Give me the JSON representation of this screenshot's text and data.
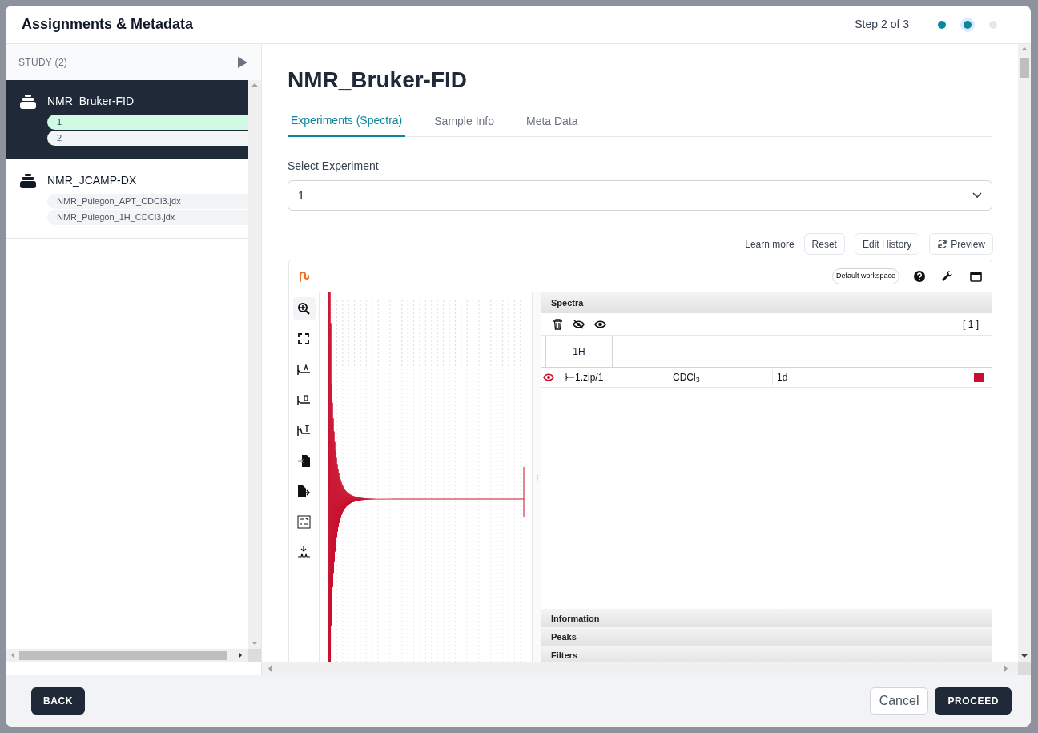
{
  "window": {
    "title": "Assignments & Metadata"
  },
  "stepper": {
    "label": "Step 2 of 3",
    "steps": [
      {
        "completed": true,
        "selected": false
      },
      {
        "completed": true,
        "selected": true
      },
      {
        "completed": false,
        "selected": false
      }
    ]
  },
  "sidebar": {
    "header": "STUDY (2)",
    "items": [
      {
        "name": "NMR_Bruker-FID",
        "selected": true,
        "children": [
          {
            "label": "1",
            "selected": true
          },
          {
            "label": "2",
            "selected": false
          }
        ]
      },
      {
        "name": "NMR_JCAMP-DX",
        "selected": false,
        "children": [
          {
            "label": "NMR_Pulegon_APT_CDCl3.jdx",
            "selected": false
          },
          {
            "label": "NMR_Pulegon_1H_CDCl3.jdx",
            "selected": false
          }
        ]
      }
    ]
  },
  "main": {
    "title": "NMR_Bruker-FID",
    "tabs": [
      {
        "label": "Experiments (Spectra)",
        "selected": true
      },
      {
        "label": "Sample Info",
        "selected": false
      },
      {
        "label": "Meta Data",
        "selected": false
      }
    ],
    "select": {
      "label": "Select Experiment",
      "value": "1"
    },
    "actions": [
      {
        "kind": "link",
        "label": "Learn more"
      },
      {
        "kind": "button",
        "label": "Reset"
      },
      {
        "kind": "button",
        "label": "Edit History"
      },
      {
        "kind": "refresh",
        "label": "Preview"
      }
    ]
  },
  "viewer": {
    "workspace": "Default workspace",
    "spectra_title": "Spectra",
    "count": "[ 1 ]",
    "nuclei": [
      {
        "label": "1H",
        "selected": true
      }
    ],
    "rows": [
      {
        "visible": true,
        "name": "1.zip/1",
        "solvent": "CDCl$_{3}$",
        "dimension": "1d",
        "color": "#c8102e"
      }
    ],
    "sections": [
      "Information",
      "Peaks",
      "Filters"
    ]
  },
  "footer": {
    "back": "BACK",
    "cancel": "Cancel",
    "proceed": "PROCEED"
  }
}
